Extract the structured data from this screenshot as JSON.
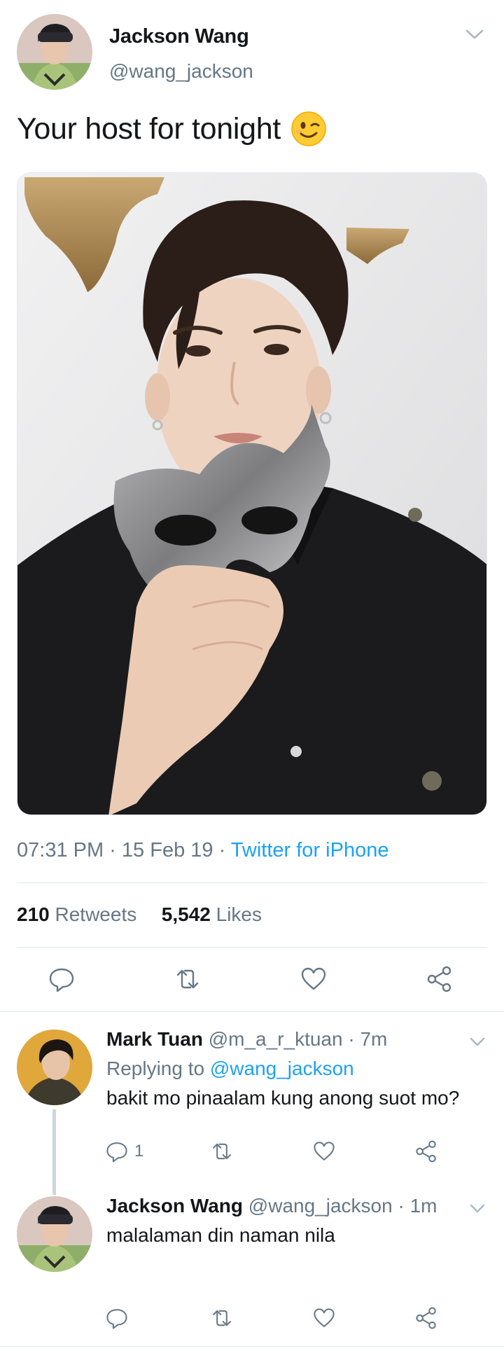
{
  "tweet": {
    "author_name": "Jackson Wang",
    "author_handle": "@wang_jackson",
    "text": "Your host for tonight",
    "emoji": "winking-face",
    "time": "07:31 PM",
    "date": "15 Feb 19",
    "source": "Twitter for iPhone",
    "retweets_count": "210",
    "retweets_label": "Retweets",
    "likes_count": "5,542",
    "likes_label": "Likes"
  },
  "replies": [
    {
      "name": "Mark Tuan",
      "handle": "@m_a_r_ktuan",
      "time": "7m",
      "replying_prefix": "Replying to",
      "replying_to": "@wang_jackson",
      "text": "bakit mo pinaalam kung anong suot mo?",
      "reply_count": "1"
    },
    {
      "name": "Jackson Wang",
      "handle": "@wang_jackson",
      "time": "1m",
      "text": "malalaman din naman nila"
    }
  ],
  "colors": {
    "accent": "#1da1f2",
    "muted": "#657786",
    "text": "#14171a",
    "divider": "#e1e8ed"
  },
  "icons": [
    "chevron-down-icon",
    "reply-icon",
    "retweet-icon",
    "like-icon",
    "share-icon"
  ]
}
